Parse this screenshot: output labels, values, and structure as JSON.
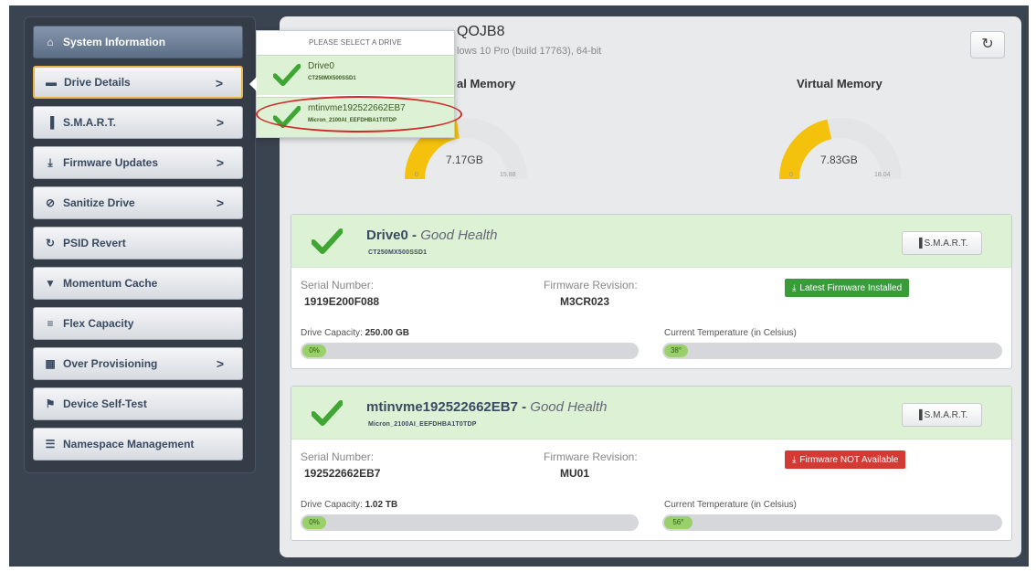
{
  "sidebar": {
    "items": [
      {
        "label": "System Information",
        "icon": "home-icon",
        "glyph": "⌂",
        "chevron": ""
      },
      {
        "label": "Drive Details",
        "icon": "drive-icon",
        "glyph": "▬",
        "chevron": ">"
      },
      {
        "label": "S.M.A.R.T.",
        "icon": "bar-chart-icon",
        "glyph": "▐",
        "chevron": ">"
      },
      {
        "label": "Firmware Updates",
        "icon": "download-icon",
        "glyph": "⤓",
        "chevron": ">"
      },
      {
        "label": "Sanitize Drive",
        "icon": "ban-icon",
        "glyph": "⊘",
        "chevron": ">"
      },
      {
        "label": "PSID Revert",
        "icon": "revert-icon",
        "glyph": "↻",
        "chevron": ""
      },
      {
        "label": "Momentum Cache",
        "icon": "filter-icon",
        "glyph": "▼",
        "chevron": ""
      },
      {
        "label": "Flex Capacity",
        "icon": "align-icon",
        "glyph": "≡",
        "chevron": ""
      },
      {
        "label": "Over Provisioning",
        "icon": "grid-icon",
        "glyph": "▦",
        "chevron": ">"
      },
      {
        "label": "Device Self-Test",
        "icon": "flag-icon",
        "glyph": "⚑",
        "chevron": ""
      },
      {
        "label": "Namespace Management",
        "icon": "storage-icon",
        "glyph": "☰",
        "chevron": ""
      }
    ]
  },
  "header": {
    "host": "QOJB8",
    "os": "lows 10 Pro (build 17763), 64-bit",
    "refresh_glyph": "↻"
  },
  "gauges": [
    {
      "title": "al Memory",
      "value": "7.17GB",
      "min": "0",
      "max": "15.88",
      "fill_fraction": 0.45
    },
    {
      "title": "Virtual Memory",
      "value": "7.83GB",
      "min": "0",
      "max": "18.04",
      "fill_fraction": 0.43
    }
  ],
  "dropdown": {
    "header": "PLEASE SELECT A DRIVE",
    "items": [
      {
        "name": "Drive0",
        "model": "CT250MX500SSD1"
      },
      {
        "name": "mtinvme192522662EB7",
        "model": "Micron_2100AI_EEFDHBA1T0TDP"
      }
    ]
  },
  "drives": [
    {
      "name": "Drive0",
      "health": "Good Health",
      "model": "CT250MX500SSD1",
      "smart_label": "S.M.A.R.T.",
      "serial_label": "Serial Number:",
      "serial": "1919E200F088",
      "fw_label": "Firmware Revision:",
      "fw": "M3CR023",
      "fw_status": "Latest Firmware Installed",
      "fw_status_kind": "ok",
      "capacity_label": "Drive Capacity:",
      "capacity": "250.00 GB",
      "usage_pct": 0,
      "usage_text": "0%",
      "temp_label": "Current Temperature (in Celsius)",
      "temp": 38,
      "temp_text": "38°"
    },
    {
      "name": "mtinvme192522662EB7",
      "health": "Good Health",
      "model": "Micron_2100AI_EEFDHBA1T0TDP",
      "smart_label": "S.M.A.R.T.",
      "serial_label": "Serial Number:",
      "serial": "192522662EB7",
      "fw_label": "Firmware Revision:",
      "fw": "MU01",
      "fw_status": "Firmware NOT Available",
      "fw_status_kind": "bad",
      "capacity_label": "Drive Capacity:",
      "capacity": "1.02 TB",
      "usage_pct": 0,
      "usage_text": "0%",
      "temp_label": "Current Temperature (in Celsius)",
      "temp": 56,
      "temp_text": "56°"
    }
  ],
  "colors": {
    "accent_green": "#3a9b3a",
    "alert_red": "#d43a34",
    "gauge_yellow": "#f4c20d",
    "health_bg": "#ddf1d5"
  }
}
